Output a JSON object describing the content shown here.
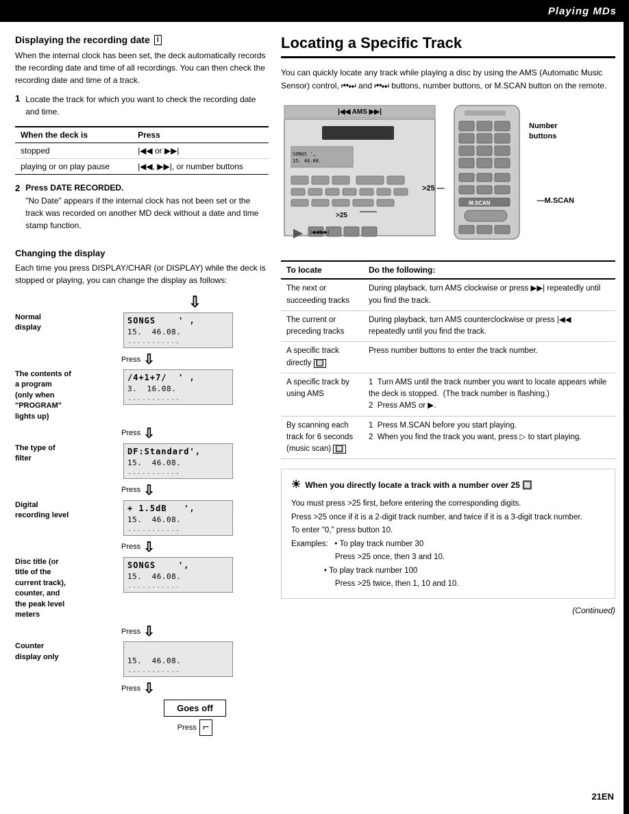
{
  "header": {
    "title": "Playing MDs"
  },
  "left": {
    "display_date_heading": "Displaying the recording date",
    "display_date_icon": "i",
    "display_date_text": "When the internal clock has been set, the deck automatically records the recording date and time of all recordings.  You can then check the recording date and time of a track.",
    "step1_label": "1",
    "step1_text": "Locate the track for which you want to check the recording date and time.",
    "table_headers": [
      "When the deck is",
      "Press"
    ],
    "table_rows": [
      [
        "stopped",
        "⏮ or ⏭"
      ],
      [
        "playing or on play pause",
        "⏮, ⏭, or number buttons"
      ]
    ],
    "step2_label": "2",
    "step2_heading": "Press DATE RECORDED.",
    "step2_text": "\"No Date\" appears if the internal clock has not been set or the track was recorded on another MD deck without a date and time stamp function.",
    "changing_display_heading": "Changing the display",
    "changing_display_text": "Each time you press DISPLAY/CHAR (or DISPLAY) while the deck is stopped or playing, you can change the display as follows:",
    "disp_rows": [
      {
        "label": "Normal\ndisplay",
        "extra": "",
        "lcd_line1": "SONGS    ' ,",
        "lcd_line2": "15.  46.08.",
        "lcd_dots": "...........",
        "has_arrow_above": false
      },
      {
        "label": "The contents of\na program\n(only when\n\"PROGRAM\"\nlights up)",
        "extra": "",
        "lcd_line1": "/4+1+7/   ' ,",
        "lcd_line2": "3.  16.08.",
        "lcd_dots": "...........",
        "has_arrow_above": true
      },
      {
        "label": "The type of\nfilter",
        "extra": "",
        "lcd_line1": "DF:Standard',",
        "lcd_line2": "15.  46.08.",
        "lcd_dots": "...........",
        "has_arrow_above": true
      },
      {
        "label": "Digital\nrecording level",
        "extra": "",
        "lcd_line1": "+ 1.5dB   ',",
        "lcd_line2": "15.  46.08.",
        "lcd_dots": "...........",
        "has_arrow_above": true
      },
      {
        "label": "Disc title (or\ntitle of the\ncurrent track),\ncounter, and\nthe peak level\nmeters",
        "extra": "",
        "lcd_line1": "SONGS    ',",
        "lcd_line2": "15.  46.08.",
        "lcd_dots": "...........",
        "has_arrow_above": true
      },
      {
        "label": "Counter\ndisplay only",
        "extra": "",
        "lcd_line1": "",
        "lcd_line2": "15.  46.08.",
        "lcd_dots": "...........",
        "has_arrow_above": true
      }
    ],
    "goes_off_label": "Goes off",
    "press_label": "Press"
  },
  "right": {
    "heading": "Locating a Specific Track",
    "intro_text": "You can quickly locate any track while playing a disc by using the AMS (Automatic Music Sensor) control, ⏮⏭ and ⏮⏭ buttons, number buttons, or M.SCAN button on the remote.",
    "diagram_labels": {
      "ams_label": "⏮ AMS ⏭",
      "number_buttons": "Number\nbuttons",
      "mscan": "M.SCAN",
      "gt25": ">25"
    },
    "locate_table": {
      "headers": [
        "To locate",
        "Do the following:"
      ],
      "rows": [
        {
          "to_locate": "The next or succeeding tracks",
          "do_following": "During playback, turn AMS clockwise or press ⏭ repeatedly until you find the track."
        },
        {
          "to_locate": "The current or preceding tracks",
          "do_following": "During playback, turn AMS counterclockwise or press ⏮ repeatedly until you find the track."
        },
        {
          "to_locate": "A specific track directly 🔲",
          "do_following": "Press number buttons to enter the track number."
        },
        {
          "to_locate": "A specific track by using AMS",
          "do_following": "1  Turn AMS until the track number you want to locate appears while the deck is stopped.  (The track number is flashing.)\n2  Press AMS or ▶."
        },
        {
          "to_locate": "By scanning each track for 6 seconds (music scan) 🔲",
          "do_following": "1  Press M.SCAN before you start playing.\n2  When you find the track you want, press ▷ to start playing."
        }
      ]
    },
    "tip_heading": "When you directly locate a track with a number over 25 🔲",
    "tip_text": "You must press >25 first, before entering the corresponding digits.\nPress >25 once if it is a 2-digit track number, and twice if it is a 3-digit track number.\nTo enter \"0,\" press button 10.\nExamples:   • To play track number 30\n                    Press >25 once, then 3 and 10.\n                • To play track number 100\n                    Press >25 twice, then 1, 10 and 10.",
    "continued": "(Continued)"
  },
  "page_number": "21EN"
}
